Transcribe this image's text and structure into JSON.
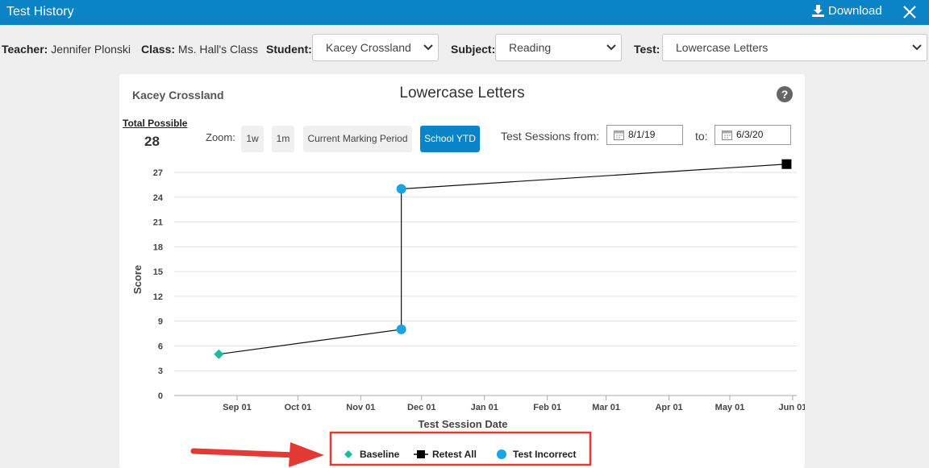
{
  "window": {
    "title": "Test History",
    "download_label": "Download"
  },
  "filters": {
    "teacher_label": "Teacher:",
    "teacher_value": "Jennifer Plonski",
    "class_label": "Class:",
    "class_value": "Ms. Hall's Class",
    "student_label": "Student:",
    "student_value": "Kacey Crossland",
    "subject_label": "Subject:",
    "subject_value": "Reading",
    "test_label": "Test:",
    "test_value": "Lowercase Letters"
  },
  "card": {
    "student_name": "Kacey Crossland",
    "title": "Lowercase Letters",
    "help_glyph": "?",
    "total_possible_label": "Total Possible",
    "total_possible_value": "28",
    "zoom_label": "Zoom:",
    "zoom_buttons": [
      "1w",
      "1m",
      "Current Marking Period",
      "School YTD"
    ],
    "zoom_active": "School YTD",
    "sessions_from_label": "Test Sessions from:",
    "from_date": "8/1/19",
    "to_label": "to:",
    "to_date": "6/3/20"
  },
  "colors": {
    "header": "#0a84c6",
    "baseline": "#1abc9c",
    "retest_all": "#000000",
    "test_incorrect": "#1aa3e8",
    "annotation": "#e53935"
  },
  "chart_data": {
    "type": "line",
    "xlabel": "Test Session Date",
    "ylabel": "Score",
    "ylim": [
      0,
      27
    ],
    "yticks": [
      "0",
      "3",
      "6",
      "9",
      "12",
      "15",
      "18",
      "21",
      "24",
      "27"
    ],
    "xticks": [
      "Sep 01",
      "Oct 01",
      "Nov 01",
      "Dec 01",
      "Jan 01",
      "Feb 01",
      "Mar 01",
      "Apr 01",
      "May 01",
      "Jun 01"
    ],
    "grid": true,
    "legend_position": "bottom",
    "points": [
      {
        "series": "Baseline",
        "date": "2019-08-23",
        "score": 5,
        "marker": "diamond"
      },
      {
        "series": "Test Incorrect",
        "date": "2019-11-21",
        "score": 8,
        "marker": "circle"
      },
      {
        "series": "Test Incorrect",
        "date": "2019-11-21",
        "score": 25,
        "marker": "circle"
      },
      {
        "series": "Retest All",
        "date": "2020-05-29",
        "score": 28,
        "marker": "square"
      }
    ],
    "legend": [
      {
        "name": "Baseline",
        "marker": "diamond"
      },
      {
        "name": "Retest All",
        "marker": "square"
      },
      {
        "name": "Test Incorrect",
        "marker": "circle"
      }
    ]
  }
}
